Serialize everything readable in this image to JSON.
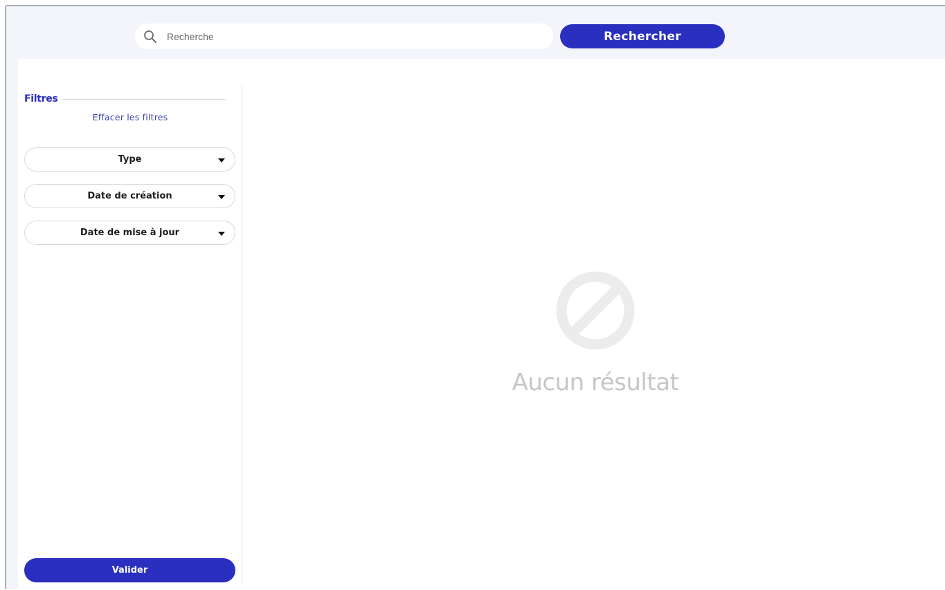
{
  "search": {
    "placeholder": "Recherche",
    "button_label": "Rechercher"
  },
  "sidebar": {
    "heading": "Filtres",
    "clear_label": "Effacer les filtres",
    "filters": [
      {
        "label": "Type"
      },
      {
        "label": "Date de création"
      },
      {
        "label": "Date de mise à jour"
      }
    ],
    "validate_label": "Valider"
  },
  "results": {
    "empty_message": "Aucun résultat",
    "icon": "no-entry-icon"
  },
  "colors": {
    "accent": "#2a2fbf",
    "page_background": "#f3f5fb",
    "empty_state": "#c6c6c6"
  }
}
